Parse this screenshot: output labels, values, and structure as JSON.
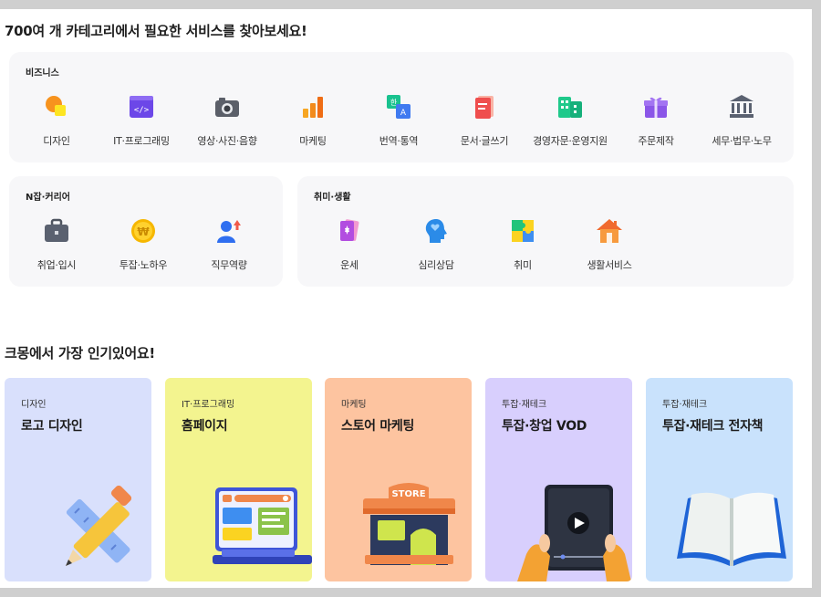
{
  "top_heading": "700여 개 카테고리에서 필요한 서비스를 찾아보세요!",
  "business": {
    "title": "비즈니스",
    "items": [
      {
        "label": "디자인",
        "icon": "design-icon"
      },
      {
        "label": "IT·프로그래밍",
        "icon": "code-icon"
      },
      {
        "label": "영상·사진·음향",
        "icon": "camera-icon"
      },
      {
        "label": "마케팅",
        "icon": "bar-chart-icon"
      },
      {
        "label": "번역·통역",
        "icon": "translate-icon"
      },
      {
        "label": "문서·글쓰기",
        "icon": "document-icon"
      },
      {
        "label": "경영자문·운영지원",
        "icon": "building-icon"
      },
      {
        "label": "주문제작",
        "icon": "gift-icon"
      },
      {
        "label": "세무·법무·노무",
        "icon": "bank-icon"
      }
    ]
  },
  "njob": {
    "title": "N잡·커리어",
    "items": [
      {
        "label": "취업·입시",
        "icon": "briefcase-icon"
      },
      {
        "label": "투잡·노하우",
        "icon": "coin-icon"
      },
      {
        "label": "직무역량",
        "icon": "person-up-icon"
      }
    ]
  },
  "hobby": {
    "title": "취미·생활",
    "items": [
      {
        "label": "운세",
        "icon": "tarot-card-icon"
      },
      {
        "label": "심리상담",
        "icon": "head-heart-icon"
      },
      {
        "label": "취미",
        "icon": "puzzle-icon"
      },
      {
        "label": "생활서비스",
        "icon": "house-icon"
      }
    ]
  },
  "popular_heading": "크몽에서 가장 인기있어요!",
  "cards": [
    {
      "category": "디자인",
      "title": "로고 디자인",
      "bg": "#d9e0fc",
      "icon": "pencil-ruler-icon"
    },
    {
      "category": "IT·프로그래밍",
      "title": "홈페이지",
      "bg": "#f3f48f",
      "icon": "laptop-icon"
    },
    {
      "category": "마케팅",
      "title": "스토어 마케팅",
      "bg": "#fdc4a0",
      "icon": "store-icon",
      "store_sign": "STORE"
    },
    {
      "category": "투잡·재테크",
      "title": "투잡·창업 VOD",
      "bg": "#d8cffd",
      "icon": "tablet-video-icon"
    },
    {
      "category": "투잡·재테크",
      "title": "투잡·재테크 전자책",
      "bg": "#c9e2fc",
      "icon": "open-book-icon"
    }
  ]
}
